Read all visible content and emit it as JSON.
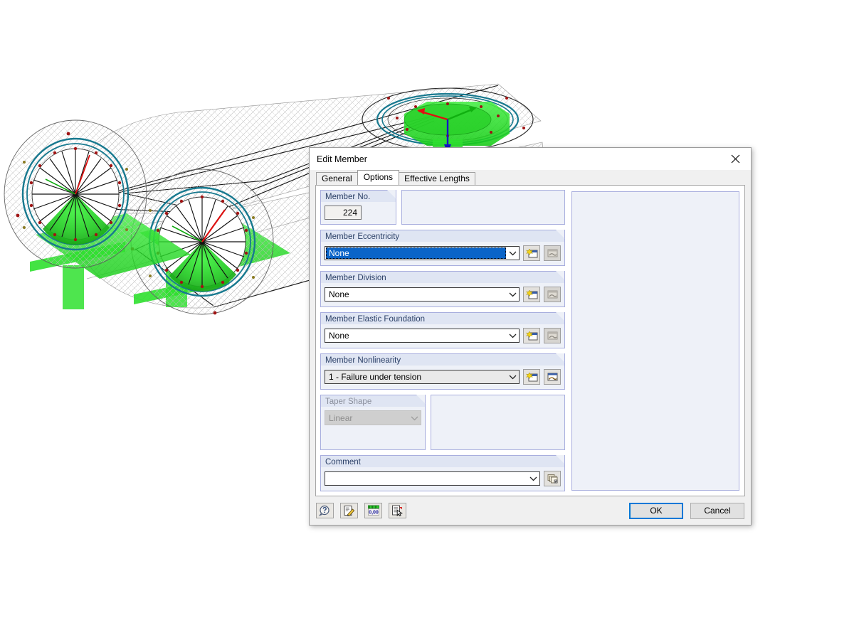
{
  "window": {
    "title": "Edit Member",
    "close_icon": "close-icon"
  },
  "tabs": [
    {
      "label": "General",
      "active": false
    },
    {
      "label": "Options",
      "active": true
    },
    {
      "label": "Effective Lengths",
      "active": false
    }
  ],
  "form": {
    "member_no": {
      "label": "Member No.",
      "value": "224"
    },
    "member_eccentricity": {
      "label": "Member Eccentricity",
      "value": "None",
      "new_button": "new-icon",
      "edit_button": "edit-icon"
    },
    "member_division": {
      "label": "Member Division",
      "value": "None",
      "new_button": "new-icon",
      "edit_button": "edit-icon"
    },
    "member_elastic_foundation": {
      "label": "Member Elastic Foundation",
      "value": "None",
      "new_button": "new-icon",
      "edit_button": "edit-icon"
    },
    "member_nonlinearity": {
      "label": "Member Nonlinearity",
      "value": "1 - Failure under tension",
      "new_button": "new-icon",
      "edit_button": "edit-icon"
    },
    "taper_shape": {
      "label": "Taper Shape",
      "value": "Linear"
    },
    "comment": {
      "label": "Comment",
      "value": "",
      "library_button": "comment-library-icon"
    }
  },
  "toolbar": {
    "help_icon": "help-icon",
    "edit_icon": "edit-pencil-icon",
    "numeric_icon": "numeric-0-00-icon",
    "pick_icon": "pick-object-icon"
  },
  "footer": {
    "ok_label": "OK",
    "cancel_label": "Cancel"
  },
  "colors": {
    "accent_focus": "#0078d7",
    "selection_blue": "#0a64c8",
    "group_header": "#dfe5f3",
    "group_border": "#a8aede",
    "panel_fill": "#eef1f8",
    "model_green": "#22dd22",
    "model_teal": "#17798f",
    "model_red": "#b01818"
  }
}
